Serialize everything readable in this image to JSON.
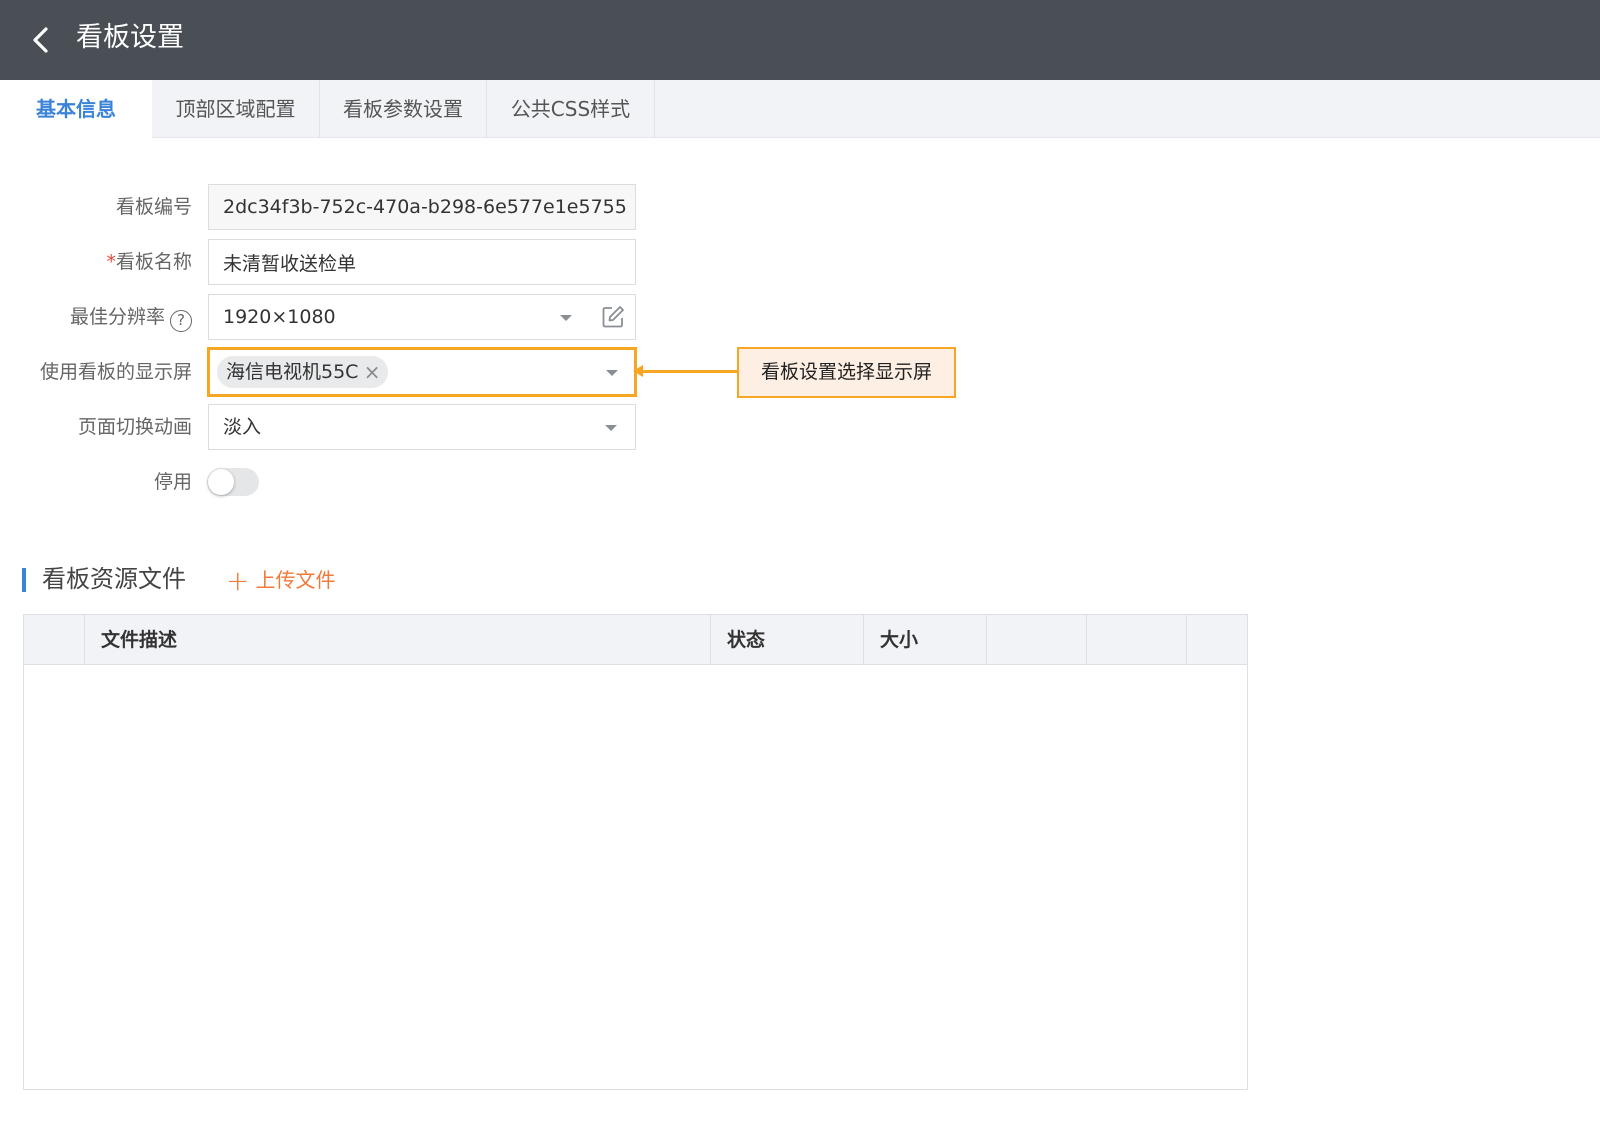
{
  "header": {
    "title": "看板设置"
  },
  "tabs": [
    {
      "label": "基本信息",
      "active": true
    },
    {
      "label": "顶部区域配置"
    },
    {
      "label": "看板参数设置"
    },
    {
      "label": "公共CSS样式"
    }
  ],
  "form": {
    "board_id": {
      "label": "看板编号",
      "value": "2dc34f3b-752c-470a-b298-6e577e1e5755"
    },
    "board_name": {
      "required_mark": "*",
      "label": "看板名称",
      "value": "未清暂收送检单"
    },
    "resolution": {
      "label": "最佳分辨率",
      "help_icon": "?",
      "value": "1920×1080"
    },
    "display_screen": {
      "label": "使用看板的显示屏",
      "tag": "海信电视机55C",
      "tag_close": "×"
    },
    "transition": {
      "label": "页面切换动画",
      "value": "淡入"
    },
    "disabled": {
      "label": "停用",
      "on": false
    }
  },
  "annotation": {
    "text": "看板设置选择显示屏",
    "color": "#f6a623"
  },
  "resources": {
    "title": "看板资源文件",
    "upload_plus": "+",
    "upload_label": "上传文件",
    "columns": [
      "",
      "文件描述",
      "状态",
      "大小",
      "",
      "",
      ""
    ]
  },
  "colors": {
    "header_bg": "#4a4f56",
    "accent": "#3a83d8",
    "upload": "#f07a3a"
  }
}
